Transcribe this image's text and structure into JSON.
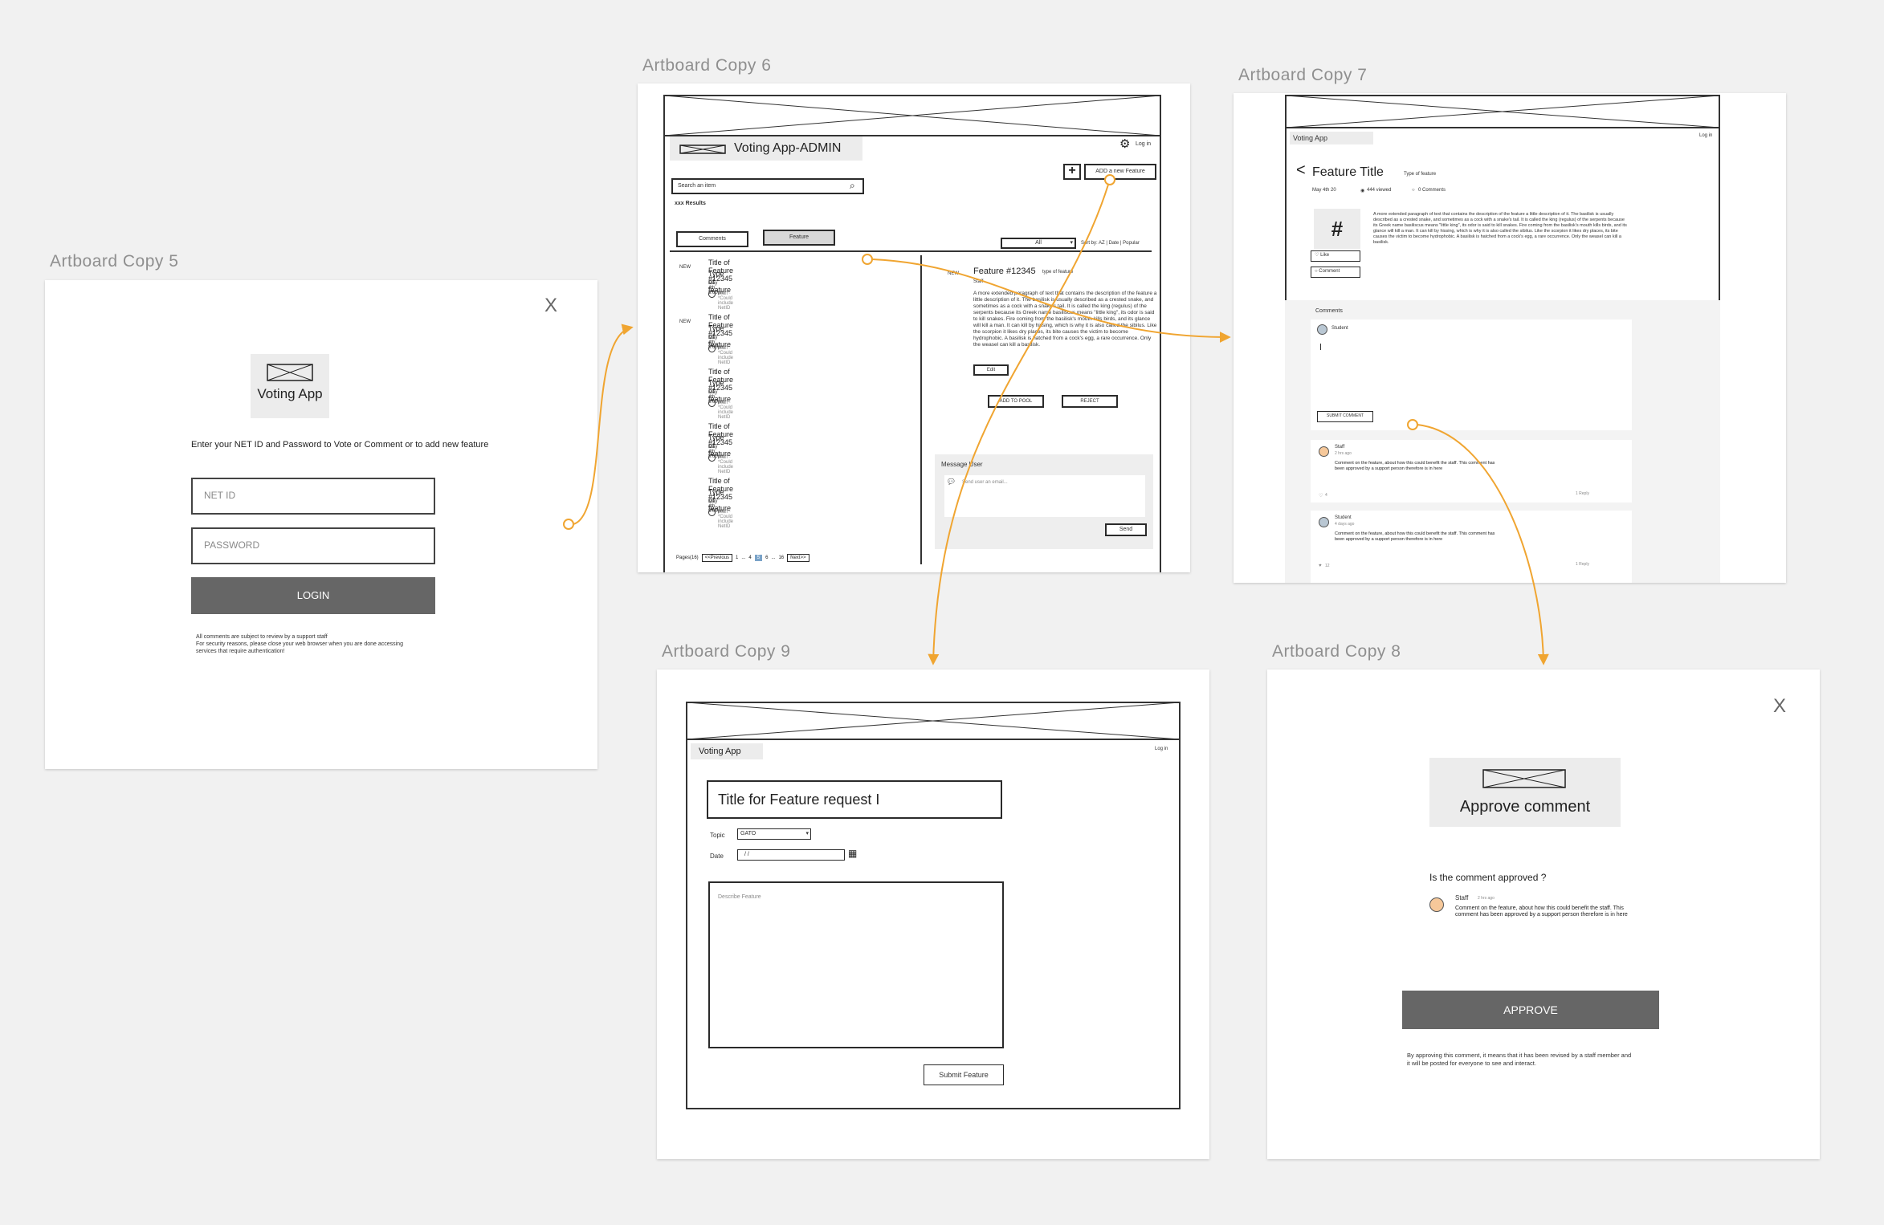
{
  "artboards": {
    "copy5": "Artboard Copy 5",
    "copy6": "Artboard Copy 6",
    "copy7": "Artboard Copy 7",
    "copy8": "Artboard Copy 8",
    "copy9": "Artboard Copy 9"
  },
  "login": {
    "close": "X",
    "logo_text": "Voting App",
    "instruction": "Enter your NET ID and Password to Vote or Comment or to add new feature",
    "netid_placeholder": "NET ID",
    "password_placeholder": "PASSWORD",
    "login_button": "LOGIN",
    "disclaimer1": "All comments are subject to review by a support staff",
    "disclaimer2": "For security reasons, please close your web browser when you are done accessing",
    "disclaimer3": "services that require authentication!"
  },
  "admin": {
    "app_title": "Voting App-ADMIN",
    "login": "Log in",
    "add_feature": "ADD a new Feature",
    "search_placeholder": "Search an item",
    "results": "xxx Results",
    "tab_comments": "Comments",
    "tab_feature": "Feature",
    "filter": "All",
    "sort": "Sort by: AZ | Date | Popular",
    "badge_new": "NEW",
    "items": [
      {
        "title": "Title of Feature #12345",
        "type": "Type of feature",
        "date": "May 4th 8:00pm",
        "meta": "Staff · *Could include NetID",
        "new": "NEW"
      },
      {
        "title": "Title of Feature #12345",
        "type": "Type of feature",
        "date": "May 4th 8:00pm",
        "meta": "Staff · *Could include NetID",
        "new": "NEW"
      },
      {
        "title": "Title of Feature #12345",
        "type": "Type of feature",
        "date": "May 4th 8:00pm",
        "meta": "Staff · *Could include NetID",
        "new": ""
      },
      {
        "title": "Title of Feature #12345",
        "type": "Type of feature",
        "date": "May 4th 8:00pm",
        "meta": "Staff · *Could include NetID",
        "new": ""
      },
      {
        "title": "Title of Feature #12345",
        "type": "Type of feature",
        "date": "May 4th 8:00pm",
        "meta": "Staff · *Could include NetID",
        "new": ""
      }
    ],
    "pages_label": "Pages(16)",
    "prev": "<<Previous",
    "next": "Next>>",
    "page_1": "1",
    "page_4": "4",
    "page_5": "5",
    "page_6": "6",
    "page_16": "16",
    "ellipsis": "...",
    "detail_title": "Feature #12345",
    "detail_type": "type of feature",
    "detail_by": "Staff",
    "detail_text": "A more extended paragraph of text that contains the description of the feature a little description of it. The basilisk is usually described as a crested snake, and sometimes as a cock with a snake's tail. It is called the king (regulus) of the serpents because its Greek name basiliscus means \"little king\", its odor is said to kill snakes. Fire coming from the basilisk's mouth kills birds, and its glance will kill a man. It can kill by hissing, which is why it is also called the sibilus. Like the scorpion it likes dry places, its bite causes the victim to become hydrophobic. A basilisk is hatched from a cock's egg, a rare occurrence. Only the weasel can kill a basilisk.",
    "edit": "Edit",
    "add_to_pool": "ADD TO POOL",
    "reject": "REJECT",
    "message_user": "Message User",
    "send_placeholder": "Send user an email...",
    "send": "Send"
  },
  "feature_view": {
    "app_title": "Voting App",
    "login": "Log in",
    "title": "Feature Title",
    "type": "Type of feature",
    "date": "May 4th 20",
    "views": "444 viewed",
    "comments_count": "0 Comments",
    "hash": "#",
    "like": "Like",
    "comment": "Comment",
    "description": "A more extended paragraph of text that contains the description of the feature a little description of it. The basilisk is usually described as a crested snake, and sometimes as a cock with a snake's tail. It is called the king (regulus) of the serpents because its Greek name basiliscus means \"little king\", its odor is said to kill snakes. Fire coming from the basilisk's mouth kills birds, and its glance will kill a man. It can kill by hissing, which is why it is also called the sibilus. Like the scorpion it likes dry places, its bite causes the victim to become hydrophobic. A basilisk is hatched from a cock's egg, a rare occurrence. Only the weasel can kill a basilisk.",
    "comments_heading": "Comments",
    "composer_user": "Student",
    "submit_comment": "SUBMIT COMMENT",
    "comment1_user": "Staff",
    "comment1_time": "2 hrs ago",
    "comment1_text": "Comment on the feature, about how this could benefit the staff. This comment has been approved by a support person therefore is in here",
    "comment1_likes": "4",
    "comment1_reply": "1 Reply",
    "comment2_user": "Student",
    "comment2_time": "4 days ago",
    "comment2_text": "Comment on the feature, about how this could benefit the staff. This comment has been approved by a support person therefore is in here",
    "comment2_likes": "12",
    "comment2_reply": "1 Reply"
  },
  "new_feature": {
    "app_title": "Voting App",
    "login": "Log in",
    "title_value": "Title for Feature request  I",
    "topic_label": "Topic",
    "topic_value": "GATO",
    "date_label": "Date",
    "date_value": "/  /",
    "describe_placeholder": "Describe Feature",
    "submit": "Submit Feature"
  },
  "approve": {
    "close": "X",
    "logo_text": "Approve comment",
    "question": "Is the comment approved ?",
    "user": "Staff",
    "time": "2 hrs ago",
    "comment": "Comment on the feature, about how this could benefit the staff. This comment has been approved by a support person therefore is in here",
    "button": "APPROVE",
    "note1": "By approving this comment, it means that it has been revised by a staff member and",
    "note2": "it will be posted for everyone to see and interact."
  },
  "colors": {
    "connector": "#f0a531",
    "avatar_orange": "#f6c89a",
    "avatar_blue": "#b9c7d3",
    "dark_button": "#666666",
    "canvas": "#f1f1f1"
  }
}
